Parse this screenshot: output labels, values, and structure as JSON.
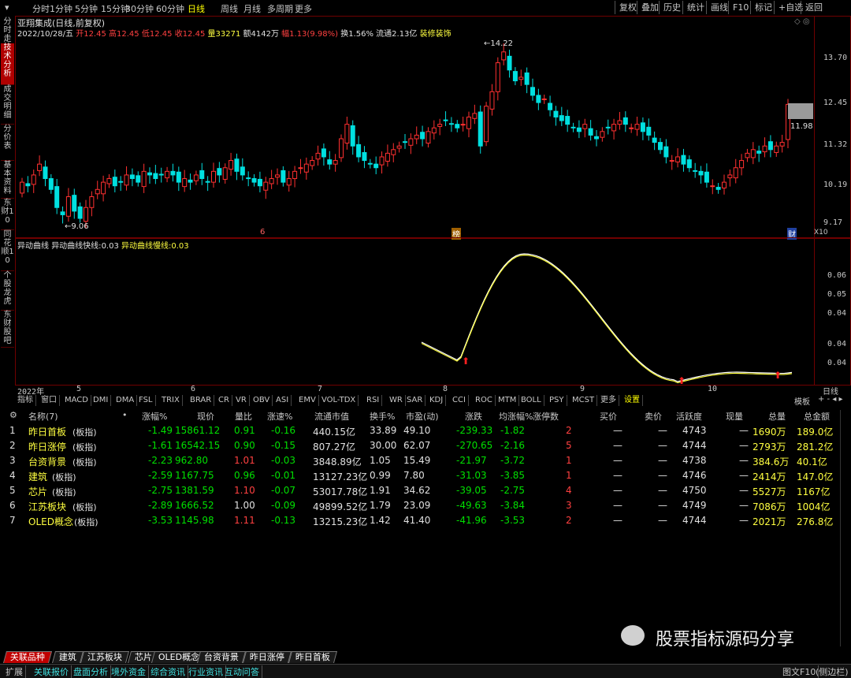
{
  "top_tabs": [
    "分时",
    "1分钟",
    "5分钟",
    "15分钟",
    "30分钟",
    "60分钟",
    "日线",
    "周线",
    "月线",
    "多周期",
    "更多"
  ],
  "top_active": "日线",
  "top_right_buttons": [
    "复权",
    "叠加",
    "历史",
    "统计",
    "画线",
    "F10",
    "标记",
    "+自选",
    "返回"
  ],
  "left_tabs": [
    "分时走势",
    "技术分析",
    "成交明细",
    "分价表",
    "基本资料",
    "东财10",
    "同花顺10",
    "个股龙虎",
    "东财股吧"
  ],
  "stock_title": "亚翔集成(日线,前复权)",
  "ohlc": {
    "date": "2022/10/28/五",
    "open_label": "开",
    "open": "12.45",
    "high_label": "高",
    "high": "12.45",
    "low_label": "低",
    "low": "12.45",
    "close_label": "收",
    "close": "12.45",
    "vol_label": "量",
    "vol": "33271",
    "amount_label": "额",
    "amount": "4142万",
    "change_label": "幅",
    "change": "1.13(9.98%)",
    "turnover_label": "换",
    "turnover": "1.56%",
    "float_label": "流通",
    "float": "2.13亿",
    "sector": "装修装饰"
  },
  "price_axis": [
    "13.70",
    "12.45",
    "11.32",
    "10.19",
    "9.17"
  ],
  "price_marks": {
    "high": "14.22",
    "low": "9.06",
    "last": "11.98"
  },
  "x10": "X10",
  "marker_cai": "财",
  "marker_bang": "榜",
  "marker_six": "6",
  "indicator": {
    "name": "异动曲线",
    "fast_label": "异动曲线快线:",
    "fast": "0.03",
    "slow_label": "异动曲线慢线:",
    "slow": "0.03",
    "axis": [
      "0.06",
      "0.05",
      "0.04",
      "0.04",
      "0.04"
    ]
  },
  "date_axis": [
    "2022年",
    "5",
    "6",
    "7",
    "8",
    "9",
    "10"
  ],
  "date_right": "日线",
  "indicator_tabs": [
    "指标",
    "窗口",
    "MACD",
    "DMI",
    "DMA",
    "FSL",
    "TRIX",
    "BRAR",
    "CR",
    "VR",
    "OBV",
    "ASI",
    "EMV",
    "VOL-TDX",
    "RSI",
    "WR",
    "SAR",
    "KDJ",
    "CCI",
    "ROC",
    "MTM",
    "BOLL",
    "PSY",
    "MCST",
    "更多",
    "设置"
  ],
  "indicator_selected": "设置",
  "indicator_right": "模板",
  "table": {
    "headers": [
      "名称(7)",
      "•",
      "涨幅%",
      "现价",
      "量比",
      "涨速%",
      "流通市值",
      "换手%",
      "市盈(动)",
      "涨跌",
      "均涨幅%",
      "涨停数",
      "买价",
      "卖价",
      "活跃度",
      "现量",
      "总量",
      "总金额"
    ],
    "rows": [
      {
        "idx": "1",
        "name": "昨日首板",
        "tag": "(板指)",
        "pct": "-1.49",
        "price": "15861.12",
        "vr": "0.91",
        "spd": "-0.16",
        "mcap": "440.15亿",
        "turn": "33.89",
        "pe": "49.10",
        "chg": "-239.33",
        "avg": "-1.82",
        "lim": "2",
        "bid": "—",
        "ask": "—",
        "act": "4743",
        "cur": "—",
        "vol": "1690万",
        "amt": "189.0亿"
      },
      {
        "idx": "2",
        "name": "昨日涨停",
        "tag": "(板指)",
        "pct": "-1.61",
        "price": "16542.15",
        "vr": "0.90",
        "spd": "-0.15",
        "mcap": "807.27亿",
        "turn": "30.00",
        "pe": "62.07",
        "chg": "-270.65",
        "avg": "-2.16",
        "lim": "5",
        "bid": "—",
        "ask": "—",
        "act": "4744",
        "cur": "—",
        "vol": "2793万",
        "amt": "281.2亿"
      },
      {
        "idx": "3",
        "name": "台资背景",
        "tag": "(板指)",
        "pct": "-2.23",
        "price": "962.80",
        "vr": "1.01",
        "spd": "-0.03",
        "mcap": "3848.89亿",
        "turn": "1.05",
        "pe": "15.49",
        "chg": "-21.97",
        "avg": "-3.72",
        "lim": "1",
        "bid": "—",
        "ask": "—",
        "act": "4738",
        "cur": "—",
        "vol": "384.6万",
        "amt": "40.1亿"
      },
      {
        "idx": "4",
        "name": "建筑",
        "tag": "(板指)",
        "pct": "-2.59",
        "price": "1167.75",
        "vr": "0.96",
        "spd": "-0.01",
        "mcap": "13127.23亿",
        "turn": "0.99",
        "pe": "7.80",
        "chg": "-31.03",
        "avg": "-3.85",
        "lim": "1",
        "bid": "—",
        "ask": "—",
        "act": "4746",
        "cur": "—",
        "vol": "2414万",
        "amt": "147.0亿"
      },
      {
        "idx": "5",
        "name": "芯片",
        "tag": "(板指)",
        "pct": "-2.75",
        "price": "1381.59",
        "vr": "1.10",
        "spd": "-0.07",
        "mcap": "53017.78亿",
        "turn": "1.91",
        "pe": "34.62",
        "chg": "-39.05",
        "avg": "-2.75",
        "lim": "4",
        "bid": "—",
        "ask": "—",
        "act": "4750",
        "cur": "—",
        "vol": "5527万",
        "amt": "1167亿"
      },
      {
        "idx": "6",
        "name": "江苏板块",
        "tag": "(板指)",
        "pct": "-2.89",
        "price": "1666.52",
        "vr": "1.00",
        "spd": "-0.09",
        "mcap": "49899.52亿",
        "turn": "1.79",
        "pe": "23.09",
        "chg": "-49.63",
        "avg": "-3.84",
        "lim": "3",
        "bid": "—",
        "ask": "—",
        "act": "4749",
        "cur": "—",
        "vol": "7086万",
        "amt": "1004亿"
      },
      {
        "idx": "7",
        "name": "OLED概念",
        "tag": "(板指)",
        "pct": "-3.53",
        "price": "1145.98",
        "vr": "1.11",
        "spd": "-0.13",
        "mcap": "13215.23亿",
        "turn": "1.42",
        "pe": "41.40",
        "chg": "-41.96",
        "avg": "-3.53",
        "lim": "2",
        "bid": "—",
        "ask": "—",
        "act": "4744",
        "cur": "—",
        "vol": "2021万",
        "amt": "276.8亿"
      }
    ]
  },
  "watermark": "股票指标源码分享",
  "bottom_tabs": [
    "关联品种",
    "建筑",
    "江苏板块",
    "芯片",
    "OLED概念",
    "台资背景",
    "昨日涨停",
    "昨日首板"
  ],
  "status_items": [
    "扩展",
    "关联报价",
    "盘面分析",
    "境外资金",
    "综合资讯",
    "行业资讯",
    "互动问答"
  ],
  "status_right": [
    "图文F10",
    "(侧边栏)"
  ],
  "colors": {
    "up": "#ff3030",
    "down": "#00e0e0",
    "frame": "#700000",
    "fast": "#ffff40",
    "slow": "#ffffff"
  }
}
